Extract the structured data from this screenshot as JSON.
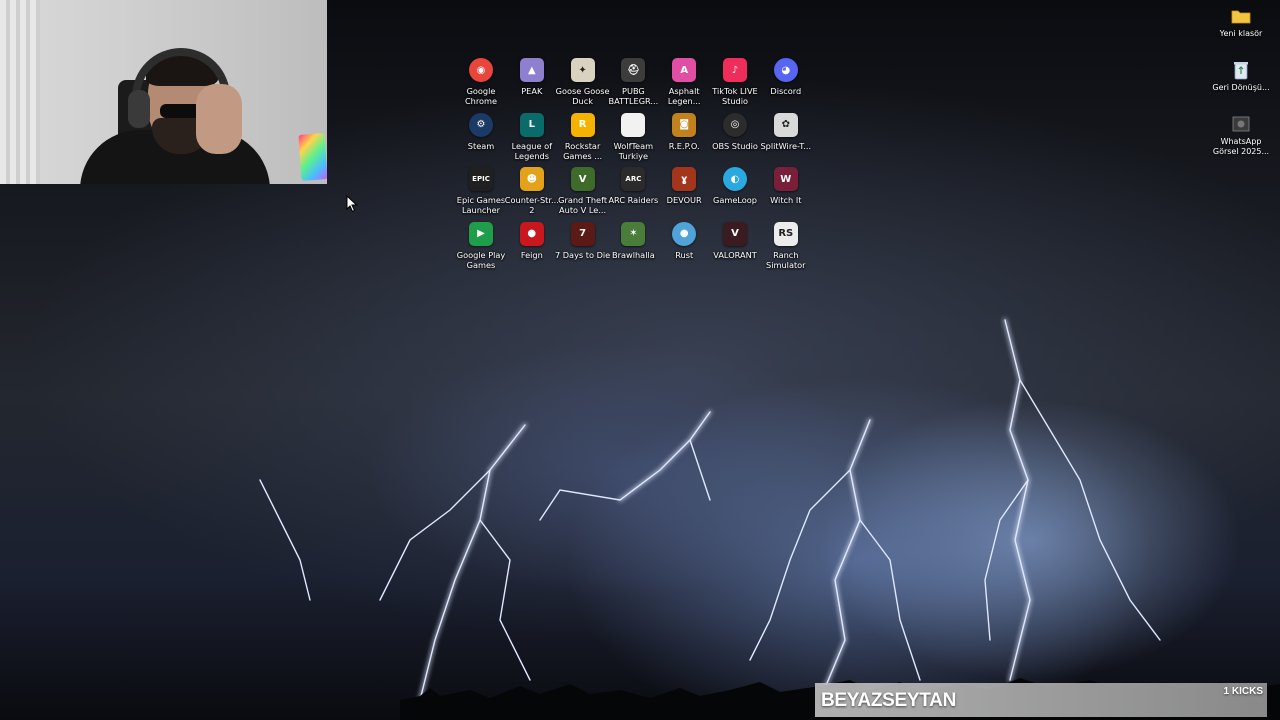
{
  "desktop": {
    "wallpaper": "lightning-storm",
    "icons": [
      {
        "label": "Google Chrome",
        "icon": "chrome-icon",
        "color": "#e8453c",
        "glyph": "◉"
      },
      {
        "label": "PEAK",
        "icon": "peak-icon",
        "color": "#8f7fcf",
        "glyph": "▲"
      },
      {
        "label": "Goose Goose Duck",
        "icon": "goose-icon",
        "color": "#d9d2c0",
        "glyph": "✦"
      },
      {
        "label": "PUBG BATTLEGR...",
        "icon": "pubg-icon",
        "color": "#3c3c3c",
        "glyph": "⛑"
      },
      {
        "label": "Asphalt Legen...",
        "icon": "asphalt-icon",
        "color": "#e04fa3",
        "glyph": "A"
      },
      {
        "label": "TikTok LIVE Studio",
        "icon": "tiktok-icon",
        "color": "#ef2c5a",
        "glyph": "♪"
      },
      {
        "label": "Discord",
        "icon": "discord-icon",
        "color": "#5865f2",
        "glyph": "◕"
      },
      {
        "label": "Steam",
        "icon": "steam-icon",
        "color": "#1b3a66",
        "glyph": "⚙"
      },
      {
        "label": "League of Legends",
        "icon": "lol-icon",
        "color": "#0a6b6b",
        "glyph": "L"
      },
      {
        "label": "Rockstar Games ...",
        "icon": "rockstar-icon",
        "color": "#f5b300",
        "glyph": "R"
      },
      {
        "label": "WolfTeam Turkiye",
        "icon": "file-icon",
        "color": "#f2f2f2",
        "glyph": ""
      },
      {
        "label": "R.E.P.O.",
        "icon": "repo-icon",
        "color": "#c2811f",
        "glyph": "◙"
      },
      {
        "label": "OBS Studio",
        "icon": "obs-icon",
        "color": "#2c2c2c",
        "glyph": "◎"
      },
      {
        "label": "SplitWire-T...",
        "icon": "splitwire-icon",
        "color": "#d9d9d9",
        "glyph": "✿"
      },
      {
        "label": "Epic Games Launcher",
        "icon": "epic-icon",
        "color": "#202020",
        "glyph": "EPIC"
      },
      {
        "label": "Counter-Str... 2",
        "icon": "cs2-icon",
        "color": "#e3a21a",
        "glyph": "☻"
      },
      {
        "label": "Grand Theft Auto V Le...",
        "icon": "gta-icon",
        "color": "#3f6b2a",
        "glyph": "V"
      },
      {
        "label": "ARC Raiders",
        "icon": "arc-raiders-icon",
        "color": "#2b2b2b",
        "glyph": "ARC"
      },
      {
        "label": "DEVOUR",
        "icon": "devour-icon",
        "color": "#a2351b",
        "glyph": "ɣ"
      },
      {
        "label": "GameLoop",
        "icon": "gameloop-icon",
        "color": "#2aa8e0",
        "glyph": "◐"
      },
      {
        "label": "Witch It",
        "icon": "witch-it-icon",
        "color": "#7a1f3a",
        "glyph": "W"
      },
      {
        "label": "Google Play Games",
        "icon": "play-games-icon",
        "color": "#1e9e4a",
        "glyph": "▶"
      },
      {
        "label": "Feign",
        "icon": "feign-icon",
        "color": "#c8181e",
        "glyph": "●"
      },
      {
        "label": "7 Days to Die",
        "icon": "7dtd-icon",
        "color": "#5b1a16",
        "glyph": "7"
      },
      {
        "label": "Brawlhalla",
        "icon": "brawlhalla-icon",
        "color": "#4a7d3a",
        "glyph": "✶"
      },
      {
        "label": "Rust",
        "icon": "rust-icon",
        "color": "#4fa3d8",
        "glyph": "●"
      },
      {
        "label": "VALORANT",
        "icon": "valorant-icon",
        "color": "#3a1b20",
        "glyph": "V"
      },
      {
        "label": "Ranch Simulator",
        "icon": "ranch-icon",
        "color": "#ececec",
        "glyph": "RS"
      }
    ],
    "side_icons": [
      {
        "label": "Yeni klasör",
        "icon": "folder-icon"
      },
      {
        "label": "Geri Dönüşü...",
        "icon": "recycle-bin-icon"
      },
      {
        "label": "WhatsApp Görsel 2025...",
        "icon": "image-file-icon"
      }
    ]
  },
  "webcam": {
    "label": "streamer-webcam"
  },
  "kick_overlay": {
    "name": "BEYAZSEYTAN",
    "count": "1 KICKS"
  }
}
